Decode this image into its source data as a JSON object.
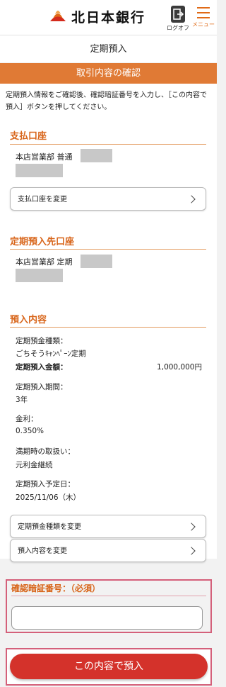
{
  "header": {
    "bank_name": "北日本銀行",
    "logout_label": "ログオフ",
    "menu_label": "メニュー"
  },
  "page_title": "定期預入",
  "banner": "取引内容の確認",
  "intro": "定期預入情報をご確認後、確認暗証番号を入力し、［この内容で預入］ボタンを押してください。",
  "payment_account": {
    "title": "支払口座",
    "account_text": "本店営業部 普通",
    "change_button": "支払口座を変更"
  },
  "deposit_account": {
    "title": "定期預入先口座",
    "account_text": "本店営業部 定期"
  },
  "deposit_details": {
    "title": "預入内容",
    "type_label": "定期預金種類：",
    "type_value": "ごちそうｷｬﾝﾍﾟｰﾝ定期",
    "amount_label": "定期預入金額：",
    "amount_value": "1,000,000円",
    "period_label": "定期預入期間：",
    "period_value": "3年",
    "rate_label": "金利：",
    "rate_value": "0.350%",
    "maturity_label": "満期時の取扱い：",
    "maturity_value": "元利金継続",
    "date_label": "定期預入予定日：",
    "date_value": "2025/11/06（木）",
    "change_type_button": "定期預金種類を変更",
    "change_details_button": "預入内容を変更"
  },
  "pin": {
    "title": "確認暗証番号：（必須）",
    "value": ""
  },
  "submit_label": "この内容で預入",
  "colors": {
    "accent_orange": "#e07a35",
    "title_orange": "#d8651a",
    "submit_red": "#d4322b",
    "highlight_frame": "#d4607a"
  }
}
